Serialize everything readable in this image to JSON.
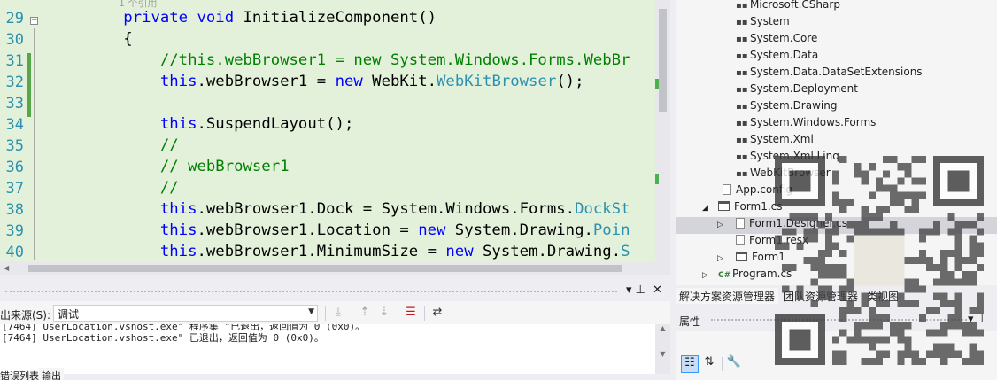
{
  "editor": {
    "ref_label": "1 个引用",
    "line_numbers": [
      "29",
      "30",
      "31",
      "32",
      "33",
      "34",
      "35",
      "36",
      "37",
      "38",
      "39",
      "40"
    ],
    "lines": [
      {
        "indent": "        ",
        "parts": [
          {
            "t": "private",
            "c": "kw"
          },
          {
            "t": " ",
            "c": "pl"
          },
          {
            "t": "void",
            "c": "kw"
          },
          {
            "t": " InitializeComponent()",
            "c": "pl"
          }
        ]
      },
      {
        "indent": "        ",
        "parts": [
          {
            "t": "{",
            "c": "pl"
          }
        ]
      },
      {
        "indent": "            ",
        "parts": [
          {
            "t": "//this.webBrowser1 = new System.Windows.Forms.WebBr",
            "c": "cm"
          }
        ]
      },
      {
        "indent": "            ",
        "parts": [
          {
            "t": "this",
            "c": "kw"
          },
          {
            "t": ".webBrowser1 = ",
            "c": "pl"
          },
          {
            "t": "new",
            "c": "kw"
          },
          {
            "t": " WebKit.",
            "c": "pl"
          },
          {
            "t": "WebKitBrowser",
            "c": "ty"
          },
          {
            "t": "();",
            "c": "pl"
          }
        ]
      },
      {
        "indent": "",
        "parts": []
      },
      {
        "indent": "            ",
        "parts": [
          {
            "t": "this",
            "c": "kw"
          },
          {
            "t": ".SuspendLayout();",
            "c": "pl"
          }
        ]
      },
      {
        "indent": "            ",
        "parts": [
          {
            "t": "//",
            "c": "cm"
          }
        ]
      },
      {
        "indent": "            ",
        "parts": [
          {
            "t": "// webBrowser1",
            "c": "cm"
          }
        ]
      },
      {
        "indent": "            ",
        "parts": [
          {
            "t": "//",
            "c": "cm"
          }
        ]
      },
      {
        "indent": "            ",
        "parts": [
          {
            "t": "this",
            "c": "kw"
          },
          {
            "t": ".webBrowser1.Dock = System.Windows.Forms.",
            "c": "pl"
          },
          {
            "t": "DockSt",
            "c": "ty"
          }
        ]
      },
      {
        "indent": "            ",
        "parts": [
          {
            "t": "this",
            "c": "kw"
          },
          {
            "t": ".webBrowser1.Location = ",
            "c": "pl"
          },
          {
            "t": "new",
            "c": "kw"
          },
          {
            "t": " System.Drawing.",
            "c": "pl"
          },
          {
            "t": "Poin",
            "c": "ty"
          }
        ]
      },
      {
        "indent": "            ",
        "parts": [
          {
            "t": "this",
            "c": "kw"
          },
          {
            "t": ".webBrowser1.MinimumSize = ",
            "c": "pl"
          },
          {
            "t": "new",
            "c": "kw"
          },
          {
            "t": " System.Drawing.",
            "c": "pl"
          },
          {
            "t": "S",
            "c": "ty"
          }
        ]
      }
    ],
    "zoom_arrow": "◀"
  },
  "output": {
    "pin": "▾ ⊥",
    "close": "✕",
    "source_label": "出来源(S):",
    "source_value": "调试",
    "lines": [
      "[7464] UserLocation.vshost.exe\" 程序集 \"已退出，返回值为 0 (0x0)。",
      "[7464] UserLocation.vshost.exe\" 已退出，返回值为 0 (0x0)。"
    ],
    "tabs": [
      "错误列表",
      "输出"
    ]
  },
  "solution": {
    "refs": [
      "Microsoft.CSharp",
      "System",
      "System.Core",
      "System.Data",
      "System.Data.DataSetExtensions",
      "System.Deployment",
      "System.Drawing",
      "System.Windows.Forms",
      "System.Xml",
      "System.Xml.Linq",
      "WebKitBrowser"
    ],
    "app_config": "App.config",
    "form1_cs": "Form1.cs",
    "form1_designer": "Form1.Designer.cs",
    "form1_resx": "Form1.resx",
    "form1_class": "Form1",
    "program_cs": "Program.cs",
    "tabs": [
      "解决方案资源管理器",
      "团队资源管理器",
      "类视图"
    ]
  },
  "properties": {
    "title": "属性",
    "pin": "▾ ⊥"
  },
  "icons": {
    "ref_icon": "reference-icon",
    "cs_icon": "csharp-file-icon",
    "accent_green": "#57A64A",
    "editor_bg": "#E3F1DB"
  }
}
